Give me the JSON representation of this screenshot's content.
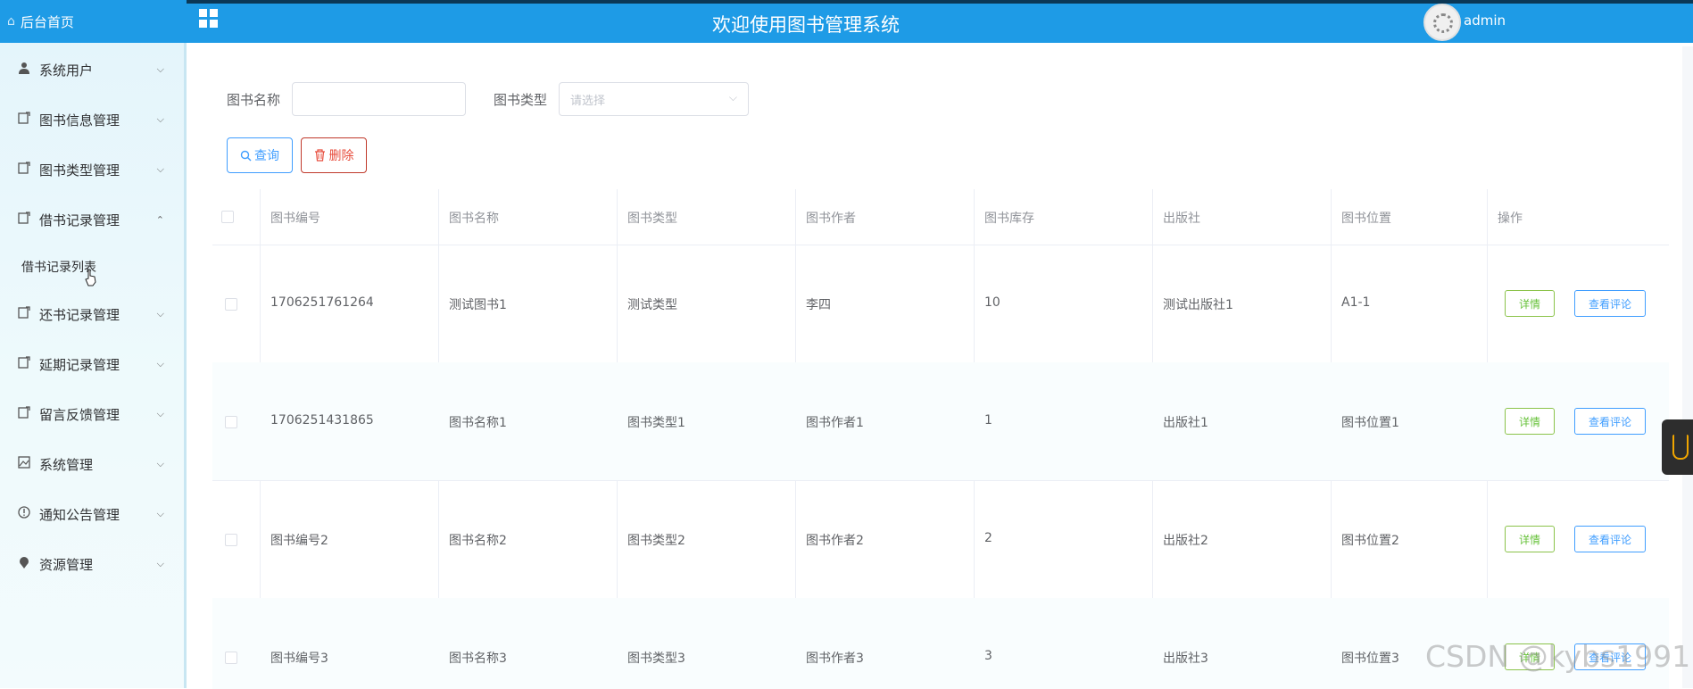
{
  "sidebar": {
    "home_label": "后台首页",
    "items": [
      {
        "label": "系统用户",
        "icon": "user-icon",
        "chevron": "⌵"
      },
      {
        "label": "图书信息管理",
        "icon": "doc-icon",
        "chevron": "⌵"
      },
      {
        "label": "图书类型管理",
        "icon": "doc-icon",
        "chevron": "⌵"
      },
      {
        "label": "借书记录管理",
        "icon": "doc-icon",
        "chevron": "⌃"
      },
      {
        "label": "还书记录管理",
        "icon": "doc-icon",
        "chevron": "⌵"
      },
      {
        "label": "延期记录管理",
        "icon": "doc-icon",
        "chevron": "⌵"
      },
      {
        "label": "留言反馈管理",
        "icon": "doc-icon",
        "chevron": "⌵"
      },
      {
        "label": "系统管理",
        "icon": "picture-icon",
        "chevron": "⌵"
      },
      {
        "label": "通知公告管理",
        "icon": "info-icon",
        "chevron": "⌵"
      },
      {
        "label": "资源管理",
        "icon": "pin-icon",
        "chevron": "⌵"
      }
    ],
    "sub_item": "借书记录列表"
  },
  "header": {
    "title": "欢迎使用图书管理系统",
    "username": "admin"
  },
  "search": {
    "name_label": "图书名称",
    "name_value": "",
    "type_label": "图书类型",
    "type_placeholder": "请选择",
    "query_button": "查询",
    "delete_button": "删除"
  },
  "table": {
    "columns": [
      "图书编号",
      "图书名称",
      "图书类型",
      "图书作者",
      "图书库存",
      "出版社",
      "图书位置",
      "操作"
    ],
    "rows": [
      [
        "1706251761264",
        "测试图书1",
        "测试类型",
        "李四",
        "10",
        "测试出版社1",
        "A1-1"
      ],
      [
        "1706251431865",
        "图书名称1",
        "图书类型1",
        "图书作者1",
        "1",
        "出版社1",
        "图书位置1"
      ],
      [
        "图书编号2",
        "图书名称2",
        "图书类型2",
        "图书作者2",
        "2",
        "出版社2",
        "图书位置2"
      ],
      [
        "图书编号3",
        "图书名称3",
        "图书类型3",
        "图书作者3",
        "3",
        "出版社3",
        "图书位置3"
      ]
    ],
    "detail_button": "详情",
    "comment_button": "查看评论"
  },
  "watermark": "CSDN @kybs1991"
}
